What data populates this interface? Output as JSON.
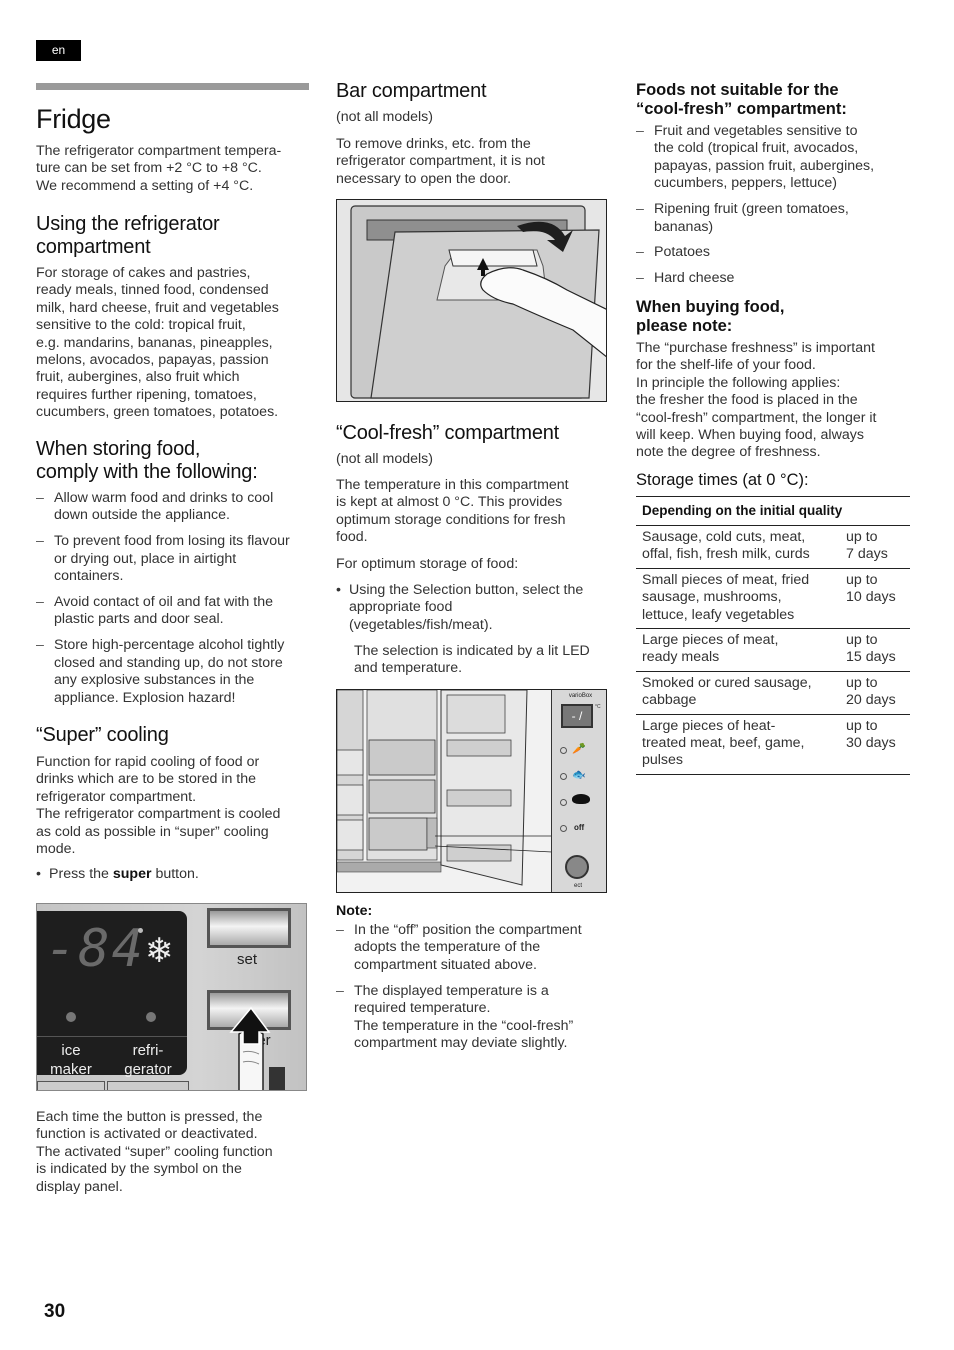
{
  "lang": "en",
  "page_number": "30",
  "col1": {
    "title": "Fridge",
    "intro": [
      "The refrigerator compartment tempera-",
      "ture can be set from +2 °C to +8 °C.",
      "We recommend a setting of +4 °C."
    ],
    "using": {
      "heading": [
        "Using the refrigerator",
        "compartment"
      ],
      "body": [
        "For storage of cakes and pastries,",
        "ready meals, tinned food, condensed",
        "milk, hard cheese, fruit and vegetables",
        "sensitive to the cold: tropical fruit,",
        "e.g. mandarins, bananas, pineapples,",
        "melons, avocados, papayas, passion",
        "fruit, aubergines, also fruit which",
        "requires further ripening, tomatoes,",
        "cucumbers, green tomatoes, potatoes."
      ]
    },
    "storing": {
      "heading": [
        "When storing food,",
        "comply with the following:"
      ],
      "items": [
        [
          "Allow warm food and drinks to cool",
          "down outside the appliance."
        ],
        [
          "To prevent food from losing its flavour",
          "or drying out, place in airtight",
          "containers."
        ],
        [
          "Avoid contact of oil and fat with the",
          "plastic parts and door seal."
        ],
        [
          "Store high-percentage alcohol tightly",
          "closed and standing up, do not store",
          "any explosive substances in the",
          "appliance. Explosion hazard!"
        ]
      ]
    },
    "super": {
      "heading": "“Super” cooling",
      "body": [
        "Function for rapid cooling of food or",
        "drinks which are to be stored in the",
        "refrigerator compartment.",
        "The refrigerator compartment is cooled",
        "as cold as possible in “super” cooling",
        "mode."
      ],
      "bullet_pre": "Press the ",
      "bullet_bold": "super",
      "bullet_post": " button.",
      "panel": {
        "display_digits": "-84",
        "snowflake": "❄",
        "label_ice": [
          "ice",
          "maker"
        ],
        "label_fridge": [
          "refri-",
          "gerator"
        ],
        "btn_set": "set",
        "btn_super": "per"
      },
      "after": [
        "Each time the button is pressed, the",
        "function is activated or deactivated.",
        "The activated “super” cooling function",
        "is indicated by the symbol on the",
        "display panel."
      ]
    }
  },
  "col2": {
    "bar": {
      "heading": "Bar compartment",
      "sub": "(not all models)",
      "body": [
        "To remove drinks, etc. from the",
        "refrigerator compartment, it is not",
        "necessary to open the door."
      ]
    },
    "coolfresh": {
      "heading": "“Cool-fresh” compartment",
      "sub": "(not all models)",
      "body": [
        "The temperature in this compartment",
        "is kept at almost 0 °C. This provides",
        "optimum storage conditions for fresh",
        "food."
      ],
      "for_optimum": "For optimum storage of food:",
      "bullet": [
        "Using the Selection button, select the",
        "appropriate food",
        "(vegetables/fish/meat)."
      ],
      "indicated": [
        "The selection is indicated by a lit LED",
        "and temperature."
      ],
      "panel": {
        "title": "varioBox",
        "display": "- /",
        "unit": "°C",
        "off_label": "off",
        "select_label": "ect"
      }
    },
    "note": {
      "label": "Note:",
      "items": [
        [
          "In the “off” position the compartment",
          "adopts the temperature of the",
          "compartment situated above."
        ],
        [
          "The displayed temperature is a",
          "required temperature.",
          "The temperature in the “cool-fresh”",
          "compartment may deviate slightly."
        ]
      ]
    }
  },
  "col3": {
    "not_suitable": {
      "heading": [
        "Foods not suitable for the",
        "“cool-fresh” compartment:"
      ],
      "items": [
        [
          "Fruit and vegetables sensitive to",
          "the cold (tropical fruit, avocados,",
          "papayas, passion fruit, aubergines,",
          "cucumbers, peppers, lettuce)"
        ],
        [
          "Ripening fruit (green tomatoes,",
          "bananas)"
        ],
        [
          "Potatoes"
        ],
        [
          "Hard cheese"
        ]
      ]
    },
    "buying": {
      "heading": [
        "When buying food,",
        "please note:"
      ],
      "body": [
        "The “purchase freshness” is important",
        "for the shelf-life of your food.",
        "In principle the following applies:",
        "the fresher the food is placed in the",
        "“cool-fresh” compartment, the longer it",
        "will keep. When buying food, always",
        "note the degree of freshness."
      ]
    },
    "storage": {
      "heading": "Storage times (at 0 °C):",
      "table_header": "Depending on the initial quality",
      "rows": [
        {
          "food": [
            "Sausage, cold cuts, meat,",
            "offal, fish, fresh milk, curds"
          ],
          "time": [
            "up to",
            "7 days"
          ]
        },
        {
          "food": [
            "Small pieces of meat, fried",
            "sausage, mushrooms,",
            "lettuce, leafy vegetables"
          ],
          "time": [
            "up to",
            "10 days"
          ]
        },
        {
          "food": [
            "Large pieces of meat,",
            "ready meals"
          ],
          "time": [
            "up to",
            "15 days"
          ]
        },
        {
          "food": [
            "Smoked or cured sausage,",
            "cabbage"
          ],
          "time": [
            "up to",
            "20 days"
          ]
        },
        {
          "food": [
            "Large pieces of heat-",
            "treated meat, beef, game,",
            "pulses"
          ],
          "time": [
            "up to",
            "30 days"
          ]
        }
      ]
    }
  }
}
